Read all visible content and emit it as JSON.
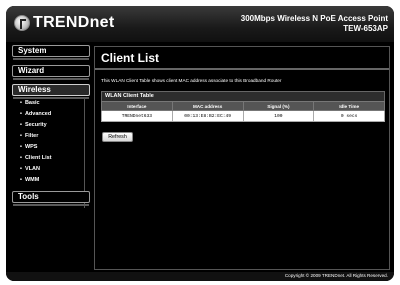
{
  "header": {
    "brand": "TRENDnet",
    "product_line": "300Mbps Wireless N PoE Access Point",
    "model": "TEW-653AP"
  },
  "sidebar": {
    "tabs": [
      {
        "label": "System"
      },
      {
        "label": "Wizard"
      },
      {
        "label": "Wireless"
      },
      {
        "label": "Tools"
      }
    ],
    "wireless_items": [
      {
        "label": "Basic"
      },
      {
        "label": "Advanced"
      },
      {
        "label": "Security"
      },
      {
        "label": "Filter"
      },
      {
        "label": "WPS"
      },
      {
        "label": "Client List"
      },
      {
        "label": "VLAN"
      },
      {
        "label": "WMM"
      }
    ]
  },
  "main": {
    "title": "Client List",
    "description": "This WLAN Client Table shows client MAC address associate to this Broadband Router",
    "table": {
      "caption": "WLAN Client Table",
      "headers": [
        "Interface",
        "MAC address",
        "Signal (%)",
        "Idle Time"
      ],
      "rows": [
        [
          "TRENDnet633",
          "00:13:E8:B2:EC:49",
          "100",
          "0 secs"
        ]
      ]
    },
    "refresh_label": "Refresh"
  },
  "footer": {
    "copyright": "Copyright © 2009 TRENDnet. All Rights Reserved."
  },
  "colors": {
    "background": "#000000",
    "header_gradient_top": "#3a3a3a",
    "table_caption_bg": "#2d2d2d",
    "table_header_bg": "#555555",
    "text": "#ffffff"
  }
}
